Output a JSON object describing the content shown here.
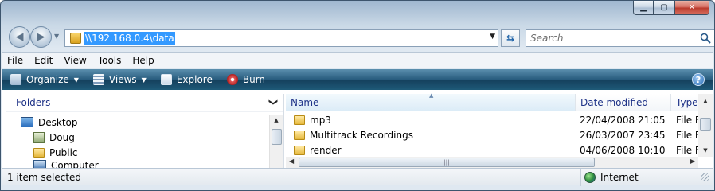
{
  "window": {
    "caption_buttons": [
      {
        "name": "minimize-icon",
        "glyph": "▁"
      },
      {
        "name": "maximize-icon",
        "glyph": "▢"
      },
      {
        "name": "close-icon",
        "glyph": "✕"
      }
    ]
  },
  "nav": {
    "back_glyph": "◀",
    "forward_glyph": "▶",
    "recent_glyph": "▼",
    "address": "\\\\192.168.0.4\\data",
    "address_drop_glyph": "▼",
    "refresh_glyph": "⇆",
    "search_placeholder": "Search"
  },
  "menu": [
    "File",
    "Edit",
    "View",
    "Tools",
    "Help"
  ],
  "commands": [
    {
      "label": "Organize",
      "caret": "▼",
      "icon": "organize-icon"
    },
    {
      "label": "Views",
      "caret": "▼",
      "icon": "views-icon"
    },
    {
      "label": "Explore",
      "caret": "",
      "icon": "explore-icon"
    },
    {
      "label": "Burn",
      "caret": "",
      "icon": "burn-icon"
    }
  ],
  "help_glyph": "?",
  "folders": {
    "title": "Folders",
    "chevron": "❯",
    "items": [
      {
        "label": "Desktop",
        "icon": "desktop-icon"
      },
      {
        "label": "Doug",
        "icon": "user-folder-icon"
      },
      {
        "label": "Public",
        "icon": "folder-icon"
      },
      {
        "label": "Computer",
        "icon": "computer-icon"
      }
    ]
  },
  "columns": {
    "name": "Name",
    "date": "Date modified",
    "type": "Type"
  },
  "files": [
    {
      "name": "mp3",
      "date": "22/04/2008 21:05",
      "type": "File F"
    },
    {
      "name": "Multitrack Recordings",
      "date": "26/03/2007 23:45",
      "type": "File F"
    },
    {
      "name": "render",
      "date": "04/06/2008 10:10",
      "type": "File F"
    }
  ],
  "scroll": {
    "up": "▲",
    "down": "▼",
    "left": "◀",
    "right": "▶",
    "grip": "|||"
  },
  "status": {
    "text": "1 item selected",
    "zone": "Internet"
  },
  "colors": {
    "accent": "#3399ff",
    "header_text": "#1e3287",
    "cmdbar_dark": "#143f5c"
  }
}
